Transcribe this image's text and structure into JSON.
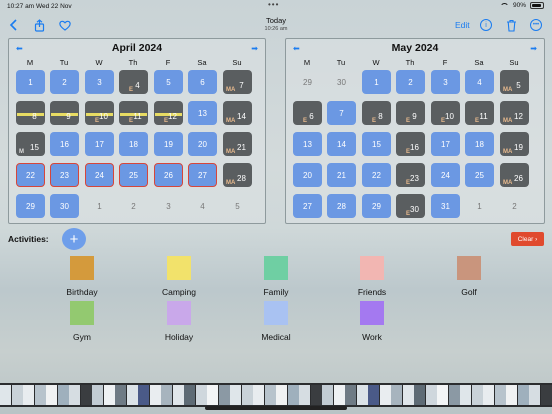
{
  "status_bar": {
    "time": "10:27 am",
    "date": "Wed 22 Nov",
    "dots": "•••",
    "battery": "90%"
  },
  "toolbar": {
    "title": "Today",
    "subtitle": "10:26 am",
    "edit_label": "Edit",
    "icons": [
      "chevron-left",
      "share",
      "heart",
      "info",
      "trash",
      "more"
    ]
  },
  "weekdays": [
    "M",
    "Tu",
    "W",
    "Th",
    "F",
    "Sa",
    "Su"
  ],
  "calendars": [
    {
      "title": "April 2024",
      "rows": [
        [
          {
            "d": "1",
            "t": "blue"
          },
          {
            "d": "2",
            "t": "blue"
          },
          {
            "d": "3",
            "t": "blue"
          },
          {
            "d": "4",
            "t": "dark",
            "s": "E"
          },
          {
            "d": "5",
            "t": "blue"
          },
          {
            "d": "6",
            "t": "blue"
          },
          {
            "d": "7",
            "t": "dark",
            "s": "MA"
          }
        ],
        [
          {
            "d": "8",
            "t": "dark",
            "y": true
          },
          {
            "d": "9",
            "t": "dark",
            "y": true
          },
          {
            "d": "10",
            "t": "dark",
            "s": "E",
            "y": true
          },
          {
            "d": "11",
            "t": "dark",
            "s": "E",
            "y": true
          },
          {
            "d": "12",
            "t": "dark",
            "s": "E",
            "y": true
          },
          {
            "d": "13",
            "t": "blue"
          },
          {
            "d": "14",
            "t": "dark",
            "s": "MA"
          }
        ],
        [
          {
            "d": "15",
            "t": "dark",
            "s": "M"
          },
          {
            "d": "16",
            "t": "blue"
          },
          {
            "d": "17",
            "t": "blue"
          },
          {
            "d": "18",
            "t": "blue"
          },
          {
            "d": "19",
            "t": "blue"
          },
          {
            "d": "20",
            "t": "blue"
          },
          {
            "d": "21",
            "t": "dark",
            "s": "MA"
          }
        ],
        [
          {
            "d": "22",
            "t": "blue",
            "r": true
          },
          {
            "d": "23",
            "t": "blue",
            "r": true
          },
          {
            "d": "24",
            "t": "blue",
            "r": true
          },
          {
            "d": "25",
            "t": "blue",
            "r": true
          },
          {
            "d": "26",
            "t": "blue",
            "r": true
          },
          {
            "d": "27",
            "t": "blue",
            "r": true
          },
          {
            "d": "28",
            "t": "dark",
            "s": "MA"
          }
        ],
        [
          {
            "d": "29",
            "t": "blue"
          },
          {
            "d": "30",
            "t": "blue"
          },
          {
            "d": "1",
            "t": "plain"
          },
          {
            "d": "2",
            "t": "plain"
          },
          {
            "d": "3",
            "t": "plain"
          },
          {
            "d": "4",
            "t": "plain"
          },
          {
            "d": "5",
            "t": "plain"
          }
        ]
      ]
    },
    {
      "title": "May 2024",
      "rows": [
        [
          {
            "d": "29",
            "t": "plain"
          },
          {
            "d": "30",
            "t": "plain"
          },
          {
            "d": "1",
            "t": "blue"
          },
          {
            "d": "2",
            "t": "blue"
          },
          {
            "d": "3",
            "t": "blue"
          },
          {
            "d": "4",
            "t": "blue"
          },
          {
            "d": "5",
            "t": "dark",
            "s": "MA"
          }
        ],
        [
          {
            "d": "6",
            "t": "dark",
            "s": "E"
          },
          {
            "d": "7",
            "t": "blue"
          },
          {
            "d": "8",
            "t": "dark",
            "s": "E"
          },
          {
            "d": "9",
            "t": "dark",
            "s": "E"
          },
          {
            "d": "10",
            "t": "dark",
            "s": "E"
          },
          {
            "d": "11",
            "t": "dark",
            "s": "E"
          },
          {
            "d": "12",
            "t": "dark",
            "s": "MA"
          }
        ],
        [
          {
            "d": "13",
            "t": "blue"
          },
          {
            "d": "14",
            "t": "blue"
          },
          {
            "d": "15",
            "t": "blue"
          },
          {
            "d": "16",
            "t": "dark",
            "s": "E"
          },
          {
            "d": "17",
            "t": "blue"
          },
          {
            "d": "18",
            "t": "blue"
          },
          {
            "d": "19",
            "t": "dark",
            "s": "MA"
          }
        ],
        [
          {
            "d": "20",
            "t": "blue"
          },
          {
            "d": "21",
            "t": "blue"
          },
          {
            "d": "22",
            "t": "blue"
          },
          {
            "d": "23",
            "t": "dark",
            "s": "E"
          },
          {
            "d": "24",
            "t": "blue"
          },
          {
            "d": "25",
            "t": "blue"
          },
          {
            "d": "26",
            "t": "dark",
            "s": "MA"
          }
        ],
        [
          {
            "d": "27",
            "t": "blue"
          },
          {
            "d": "28",
            "t": "blue"
          },
          {
            "d": "29",
            "t": "blue"
          },
          {
            "d": "30",
            "t": "dark",
            "s": "E"
          },
          {
            "d": "31",
            "t": "blue"
          },
          {
            "d": "1",
            "t": "plain"
          },
          {
            "d": "2",
            "t": "plain"
          }
        ]
      ]
    }
  ],
  "activities": {
    "label": "Activities:",
    "add_label": "+",
    "clear_label": "Clear ›",
    "items": [
      {
        "name": "Birthday",
        "color": "#d49a3c"
      },
      {
        "name": "Camping",
        "color": "#f2e26b"
      },
      {
        "name": "Family",
        "color": "#6fcfa3"
      },
      {
        "name": "Friends",
        "color": "#f2b6b2"
      },
      {
        "name": "Golf",
        "color": "#c9957d"
      },
      {
        "name": "Gym",
        "color": "#93c970"
      },
      {
        "name": "Holiday",
        "color": "#c9a8ea"
      },
      {
        "name": "Medical",
        "color": "#a9c2f2"
      },
      {
        "name": "Work",
        "color": "#a479f0"
      }
    ]
  }
}
